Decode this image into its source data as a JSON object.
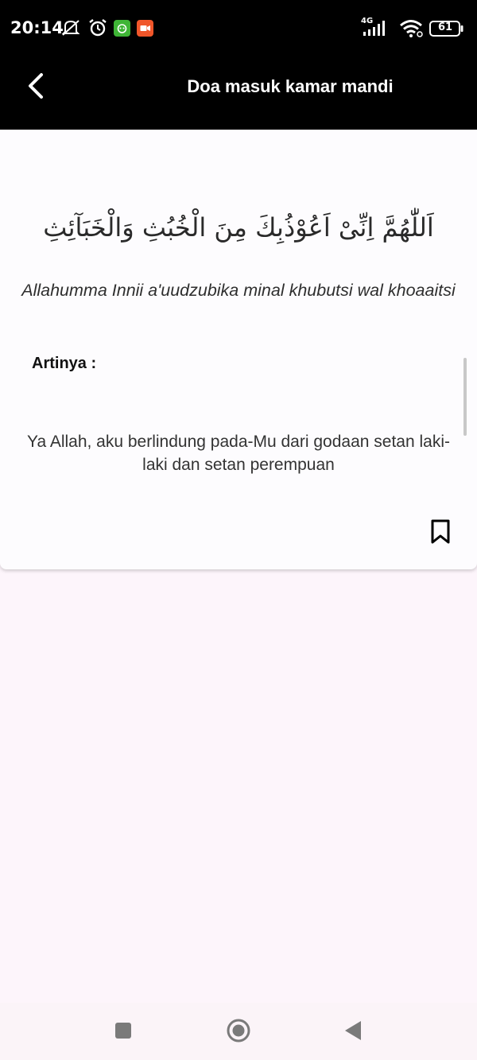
{
  "status_bar": {
    "time": "20:14",
    "network": "4G",
    "battery": "61",
    "icons": [
      "mute-bell-icon",
      "alarm-icon",
      "app-notification-icon",
      "video-record-icon",
      "signal-icon",
      "wifi-icon",
      "battery-icon"
    ]
  },
  "header": {
    "title": "Doa masuk kamar mandi",
    "back_icon": "back-arrow-icon"
  },
  "prayer": {
    "arabic": "اَللّٰهُمَّ اِنِّىْ اَعُوْذُبِكَ مِنَ الْخُبُثِ وَالْخَبَآئِثِ",
    "latin": "Allahumma Innii a'uudzubika minal khubutsi wal khoaaitsi",
    "meaning_label": "Artinya :",
    "translation": "Ya Allah, aku berlindung pada-Mu dari godaan setan laki-laki dan setan perempuan",
    "bookmark_icon": "bookmark-icon"
  },
  "nav_bar": {
    "buttons": [
      "recents-icon",
      "home-icon",
      "back-icon"
    ]
  },
  "colors": {
    "app_bar": "#000000",
    "card": "#fdfcfe",
    "background": "#fdf5fb",
    "text": "#333333"
  }
}
